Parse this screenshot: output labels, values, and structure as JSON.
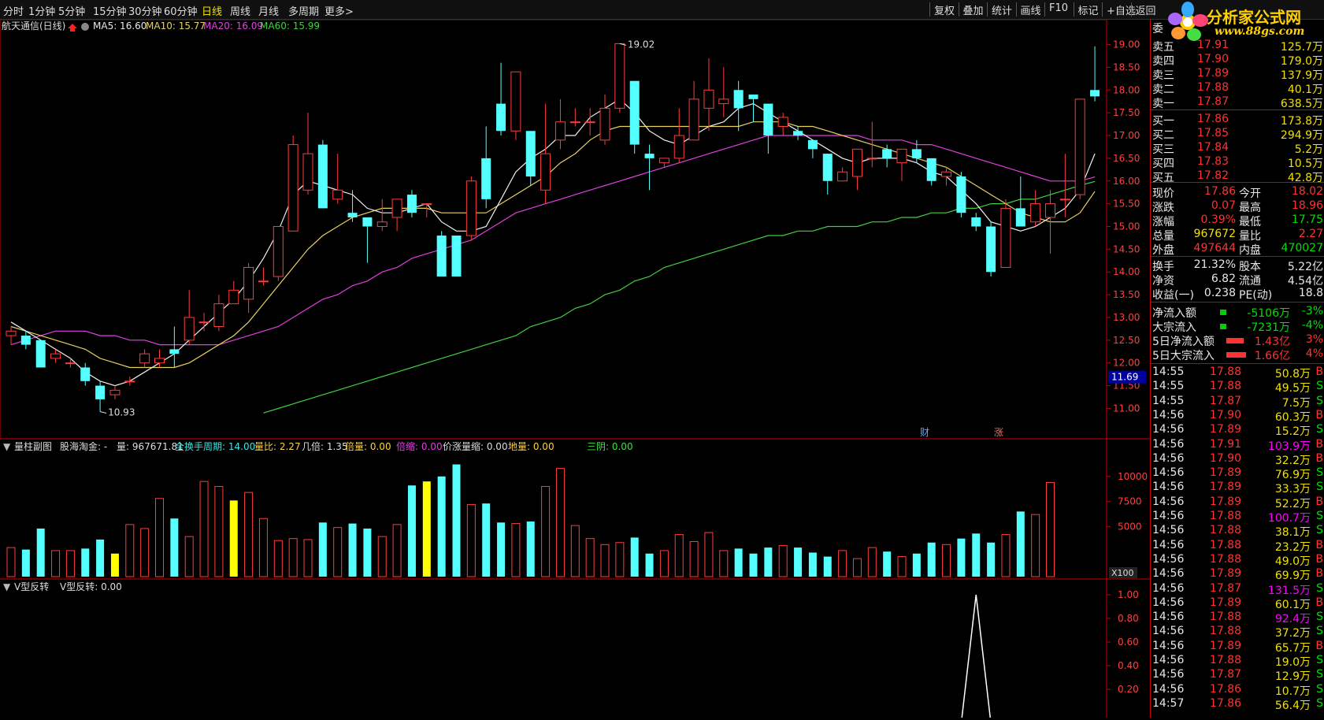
{
  "toolbar": {
    "periods": [
      "分时",
      "1分钟",
      "5分钟",
      "15分钟",
      "30分钟",
      "60分钟",
      "日线",
      "周线",
      "月线",
      "多周期",
      "更多>"
    ],
    "active_period": "日线",
    "tools": [
      "复权",
      "叠加",
      "统计",
      "画线",
      "F10",
      "标记",
      "+自选",
      "返回"
    ]
  },
  "logo": {
    "title": "分析家公式网",
    "url": "www.88gs.com"
  },
  "main_panel": {
    "stock_label": "航天通信(日线)",
    "ma5": "MA5: 16.60",
    "ma10": "MA10: 15.77",
    "ma20": "MA20: 16.09",
    "ma60": "MA60: 15.99",
    "high_mark": "19.02",
    "low_mark": "10.93",
    "current_price_tag": "11.69",
    "marker_cai": "财",
    "marker_zhang": "涨",
    "price_axis": [
      "19.00",
      "18.50",
      "18.00",
      "17.50",
      "17.00",
      "16.50",
      "16.00",
      "15.50",
      "15.00",
      "14.50",
      "14.00",
      "13.50",
      "13.00",
      "12.50",
      "12.00",
      "11.50",
      "11.00"
    ]
  },
  "volume_panel": {
    "title": "量柱副图",
    "label_gu": "股海淘金: -",
    "label_vol": "量: 967671.81",
    "label_period": "全换手周期: 14.00",
    "label_lb": "量比: 2.27",
    "label_jb": "几倍: 1.35",
    "label_bl": "倍量: 0.00",
    "label_bs": "倍缩: 0.00",
    "label_jz": "价涨量缩: 0.00",
    "label_dl": "地量: 0.00",
    "label_sy": "三阴: 0.00",
    "axis": [
      "10000",
      "7500",
      "5000"
    ],
    "unit": "X100"
  },
  "v_panel": {
    "title": "V型反转",
    "value_label": "V型反转: 0.00",
    "axis": [
      "1.00",
      "0.80",
      "0.60",
      "0.40",
      "0.20"
    ]
  },
  "quote": {
    "header": "委",
    "asks": [
      {
        "label": "卖五",
        "price": "17.91",
        "vol": "125.7万"
      },
      {
        "label": "卖四",
        "price": "17.90",
        "vol": "179.0万"
      },
      {
        "label": "卖三",
        "price": "17.89",
        "vol": "137.9万"
      },
      {
        "label": "卖二",
        "price": "17.88",
        "vol": "40.1万"
      },
      {
        "label": "卖一",
        "price": "17.87",
        "vol": "638.5万"
      }
    ],
    "bids": [
      {
        "label": "买一",
        "price": "17.86",
        "vol": "173.8万"
      },
      {
        "label": "买二",
        "price": "17.85",
        "vol": "294.9万"
      },
      {
        "label": "买三",
        "price": "17.84",
        "vol": "5.2万"
      },
      {
        "label": "买四",
        "price": "17.83",
        "vol": "10.5万"
      },
      {
        "label": "买五",
        "price": "17.82",
        "vol": "42.8万"
      }
    ],
    "stats": [
      {
        "l1": "现价",
        "v1": "17.86",
        "c1": "red",
        "l2": "今开",
        "v2": "18.02",
        "c2": "red"
      },
      {
        "l1": "涨跌",
        "v1": "0.07",
        "c1": "red",
        "l2": "最高",
        "v2": "18.96",
        "c2": "red"
      },
      {
        "l1": "涨幅",
        "v1": "0.39%",
        "c1": "red",
        "l2": "最低",
        "v2": "17.75",
        "c2": "green"
      },
      {
        "l1": "总量",
        "v1": "967672",
        "c1": "yellow",
        "l2": "量比",
        "v2": "2.27",
        "c2": "red"
      },
      {
        "l1": "外盘",
        "v1": "497644",
        "c1": "red",
        "l2": "内盘",
        "v2": "470027",
        "c2": "green"
      }
    ],
    "stats2": [
      {
        "l1": "换手",
        "v1": "21.32%",
        "c1": "white",
        "l2": "股本",
        "v2": "5.22亿",
        "c2": "white"
      },
      {
        "l1": "净资",
        "v1": "6.82",
        "c1": "white",
        "l2": "流通",
        "v2": "4.54亿",
        "c2": "white"
      },
      {
        "l1": "收益(一)",
        "v1": "0.238",
        "c1": "white",
        "l2": "PE(动)",
        "v2": "18.8",
        "c2": "white"
      }
    ],
    "flows": [
      {
        "label": "净流入额",
        "value": "-5106万",
        "pct": "-3%",
        "color": "green",
        "bar": 8
      },
      {
        "label": "大宗流入",
        "value": "-7231万",
        "pct": "-4%",
        "color": "green",
        "bar": 8
      },
      {
        "label": "5日净流入额",
        "value": "1.43亿",
        "pct": "3%",
        "color": "red",
        "bar": 22
      },
      {
        "label": "5日大宗流入",
        "value": "1.66亿",
        "pct": "4%",
        "color": "red",
        "bar": 25
      }
    ],
    "ticks": [
      {
        "t": "14:55",
        "p": "17.88",
        "v": "50.8万",
        "d": "B"
      },
      {
        "t": "14:55",
        "p": "17.88",
        "v": "49.5万",
        "d": "S"
      },
      {
        "t": "14:55",
        "p": "17.87",
        "v": "7.5万",
        "d": "S"
      },
      {
        "t": "14:56",
        "p": "17.90",
        "v": "60.3万",
        "d": "B"
      },
      {
        "t": "14:56",
        "p": "17.89",
        "v": "15.2万",
        "d": "S"
      },
      {
        "t": "14:56",
        "p": "17.91",
        "v": "103.9万",
        "d": "B"
      },
      {
        "t": "14:56",
        "p": "17.90",
        "v": "32.2万",
        "d": "B"
      },
      {
        "t": "14:56",
        "p": "17.89",
        "v": "76.9万",
        "d": "S"
      },
      {
        "t": "14:56",
        "p": "17.89",
        "v": "33.3万",
        "d": "S"
      },
      {
        "t": "14:56",
        "p": "17.89",
        "v": "52.2万",
        "d": "B"
      },
      {
        "t": "14:56",
        "p": "17.88",
        "v": "100.7万",
        "d": "S"
      },
      {
        "t": "14:56",
        "p": "17.88",
        "v": "38.1万",
        "d": "S"
      },
      {
        "t": "14:56",
        "p": "17.88",
        "v": "23.2万",
        "d": "B"
      },
      {
        "t": "14:56",
        "p": "17.88",
        "v": "49.0万",
        "d": "B"
      },
      {
        "t": "14:56",
        "p": "17.89",
        "v": "69.9万",
        "d": "B"
      },
      {
        "t": "14:56",
        "p": "17.87",
        "v": "131.5万",
        "d": "S"
      },
      {
        "t": "14:56",
        "p": "17.89",
        "v": "60.1万",
        "d": "B"
      },
      {
        "t": "14:56",
        "p": "17.88",
        "v": "92.4万",
        "d": "S"
      },
      {
        "t": "14:56",
        "p": "17.88",
        "v": "37.2万",
        "d": "S"
      },
      {
        "t": "14:56",
        "p": "17.89",
        "v": "65.7万",
        "d": "B"
      },
      {
        "t": "14:56",
        "p": "17.88",
        "v": "19.0万",
        "d": "S"
      },
      {
        "t": "14:56",
        "p": "17.87",
        "v": "12.9万",
        "d": "S"
      },
      {
        "t": "14:56",
        "p": "17.86",
        "v": "10.7万",
        "d": "S"
      },
      {
        "t": "14:57",
        "p": "17.86",
        "v": "56.4万",
        "d": "S"
      }
    ]
  },
  "chart_data": {
    "type": "candlestick",
    "ylim": [
      10.8,
      19.2
    ],
    "candles": [
      [
        12.6,
        12.7,
        12.4,
        12.8
      ],
      [
        12.6,
        12.4,
        12.3,
        12.7
      ],
      [
        12.5,
        11.9,
        11.9,
        12.5
      ],
      [
        12.1,
        12.2,
        12.0,
        12.3
      ],
      [
        12.0,
        12.0,
        11.9,
        12.1
      ],
      [
        11.9,
        11.6,
        11.5,
        12.0
      ],
      [
        11.5,
        11.2,
        10.93,
        11.6
      ],
      [
        11.3,
        11.4,
        11.2,
        11.5
      ],
      [
        11.6,
        11.6,
        11.5,
        11.7
      ],
      [
        12.0,
        12.2,
        11.9,
        12.3
      ],
      [
        12.0,
        12.1,
        11.9,
        12.3
      ],
      [
        12.3,
        12.2,
        11.9,
        12.8
      ],
      [
        12.5,
        13.0,
        12.4,
        13.6
      ],
      [
        12.9,
        12.9,
        12.7,
        13.1
      ],
      [
        12.8,
        13.3,
        12.7,
        13.5
      ],
      [
        13.3,
        13.6,
        13.3,
        13.8
      ],
      [
        13.4,
        14.1,
        13.1,
        14.2
      ],
      [
        13.8,
        13.8,
        13.7,
        14.1
      ],
      [
        13.9,
        15.0,
        13.8,
        15.0
      ],
      [
        14.9,
        16.8,
        14.9,
        17.0
      ],
      [
        15.8,
        16.6,
        15.7,
        17.5
      ],
      [
        16.8,
        15.4,
        15.4,
        16.9
      ],
      [
        15.6,
        15.8,
        15.5,
        16.6
      ],
      [
        15.3,
        15.2,
        15.1,
        15.8
      ],
      [
        15.2,
        15.0,
        14.2,
        15.2
      ],
      [
        15.0,
        15.1,
        14.9,
        15.6
      ],
      [
        15.2,
        15.6,
        14.9,
        15.6
      ],
      [
        15.7,
        15.3,
        15.2,
        15.8
      ],
      [
        15.5,
        15.5,
        15.2,
        15.5
      ],
      [
        14.8,
        13.9,
        13.9,
        14.9
      ],
      [
        14.8,
        13.9,
        13.9,
        14.8
      ],
      [
        14.8,
        16.0,
        14.7,
        16.1
      ],
      [
        16.5,
        15.6,
        15.4,
        17.2
      ],
      [
        17.7,
        17.1,
        17.0,
        18.6
      ],
      [
        17.1,
        18.4,
        16.9,
        18.4
      ],
      [
        17.1,
        16.1,
        15.9,
        16.2
      ],
      [
        15.8,
        16.6,
        15.5,
        17.7
      ],
      [
        16.9,
        17.3,
        16.7,
        17.8
      ],
      [
        17.3,
        17.3,
        17.2,
        17.6
      ],
      [
        17.3,
        17.3,
        17.0,
        17.6
      ],
      [
        16.9,
        17.6,
        16.8,
        17.9
      ],
      [
        17.6,
        19.02,
        17.5,
        19.02
      ],
      [
        18.2,
        16.8,
        16.6,
        18.2
      ],
      [
        16.6,
        16.5,
        15.8,
        16.8
      ],
      [
        16.4,
        16.5,
        16.3,
        16.5
      ],
      [
        16.5,
        17.0,
        16.4,
        17.6
      ],
      [
        16.9,
        17.8,
        16.9,
        18.2
      ],
      [
        17.6,
        18.0,
        17.1,
        18.7
      ],
      [
        17.7,
        17.8,
        17.4,
        18.5
      ],
      [
        18.0,
        17.6,
        17.1,
        18.2
      ],
      [
        17.9,
        17.8,
        17.3,
        17.9
      ],
      [
        17.7,
        17.0,
        16.6,
        17.7
      ],
      [
        17.2,
        17.4,
        17.0,
        17.5
      ],
      [
        17.1,
        17.0,
        16.9,
        17.2
      ],
      [
        16.9,
        16.7,
        16.5,
        16.9
      ],
      [
        16.6,
        16.0,
        15.7,
        16.6
      ],
      [
        16.0,
        16.2,
        16.0,
        16.3
      ],
      [
        16.1,
        16.7,
        15.8,
        16.7
      ],
      [
        16.5,
        16.5,
        16.3,
        17.3
      ],
      [
        16.7,
        16.5,
        16.3,
        16.8
      ],
      [
        16.4,
        16.7,
        16.0,
        16.7
      ],
      [
        16.7,
        16.5,
        16.4,
        16.9
      ],
      [
        16.5,
        16.0,
        15.9,
        16.5
      ],
      [
        16.1,
        16.2,
        15.9,
        16.3
      ],
      [
        16.1,
        15.3,
        15.2,
        16.2
      ],
      [
        15.2,
        15.0,
        14.9,
        15.3
      ],
      [
        15.0,
        14.0,
        13.9,
        15.1
      ],
      [
        14.1,
        15.4,
        14.1,
        15.6
      ],
      [
        15.4,
        15.0,
        15.0,
        16.1
      ],
      [
        15.1,
        15.5,
        15.0,
        15.8
      ],
      [
        15.2,
        15.5,
        14.4,
        15.8
      ],
      [
        15.6,
        15.6,
        15.2,
        16.6
      ],
      [
        15.7,
        17.8,
        15.6,
        17.8
      ],
      [
        18.0,
        17.86,
        17.75,
        18.96
      ]
    ],
    "ma5": [
      12.9,
      12.7,
      12.5,
      12.3,
      12.1,
      11.8,
      11.6,
      11.5,
      11.6,
      11.8,
      12.0,
      12.2,
      12.5,
      12.8,
      13.1,
      13.4,
      13.8,
      14.3,
      14.9,
      15.7,
      16.0,
      15.9,
      15.8,
      15.7,
      15.4,
      15.3,
      15.3,
      15.4,
      15.5,
      15.1,
      14.9,
      14.9,
      15.0,
      15.6,
      16.2,
      16.5,
      16.7,
      17.0,
      17.0,
      17.4,
      17.6,
      17.8,
      17.5,
      17.1,
      16.9,
      16.8,
      17.0,
      17.2,
      17.3,
      17.6,
      17.7,
      17.5,
      17.3,
      17.1,
      16.9,
      16.7,
      16.5,
      16.4,
      16.5,
      16.5,
      16.5,
      16.4,
      16.2,
      16.1,
      15.8,
      15.5,
      15.1,
      15.0,
      14.9,
      15.0,
      15.2,
      15.4,
      15.8,
      16.6
    ],
    "ma10": [
      12.8,
      12.7,
      12.6,
      12.5,
      12.4,
      12.3,
      12.1,
      12.0,
      11.9,
      11.9,
      11.9,
      11.9,
      12.0,
      12.2,
      12.4,
      12.6,
      12.9,
      13.3,
      13.7,
      14.1,
      14.5,
      14.8,
      15.0,
      15.2,
      15.3,
      15.4,
      15.4,
      15.4,
      15.4,
      15.3,
      15.3,
      15.3,
      15.3,
      15.5,
      15.7,
      15.9,
      16.1,
      16.4,
      16.6,
      16.9,
      17.1,
      17.2,
      17.2,
      17.2,
      17.2,
      17.2,
      17.2,
      17.2,
      17.2,
      17.2,
      17.3,
      17.3,
      17.3,
      17.2,
      17.2,
      17.1,
      17.0,
      16.9,
      16.8,
      16.7,
      16.6,
      16.5,
      16.4,
      16.3,
      16.1,
      15.9,
      15.7,
      15.5,
      15.3,
      15.2,
      15.1,
      15.1,
      15.3,
      15.77
    ],
    "ma20": [
      12.4,
      12.5,
      12.6,
      12.7,
      12.7,
      12.7,
      12.6,
      12.6,
      12.5,
      12.5,
      12.4,
      12.4,
      12.4,
      12.4,
      12.4,
      12.5,
      12.6,
      12.7,
      12.8,
      13.0,
      13.2,
      13.4,
      13.5,
      13.7,
      13.8,
      14.0,
      14.1,
      14.3,
      14.4,
      14.5,
      14.6,
      14.7,
      14.9,
      15.1,
      15.3,
      15.4,
      15.5,
      15.6,
      15.7,
      15.8,
      15.9,
      16.0,
      16.1,
      16.2,
      16.3,
      16.4,
      16.5,
      16.6,
      16.7,
      16.8,
      16.9,
      17.0,
      17.0,
      17.0,
      17.0,
      17.0,
      17.0,
      17.0,
      16.9,
      16.9,
      16.9,
      16.8,
      16.8,
      16.7,
      16.6,
      16.5,
      16.4,
      16.3,
      16.2,
      16.1,
      16.0,
      16.0,
      16.0,
      16.09
    ],
    "ma60_start": 10.9,
    "ma60": [
      10.9,
      11.0,
      11.1,
      11.2,
      11.3,
      11.4,
      11.5,
      11.6,
      11.7,
      11.8,
      11.9,
      12.0,
      12.1,
      12.2,
      12.3,
      12.4,
      12.5,
      12.6,
      12.8,
      12.9,
      13.0,
      13.2,
      13.3,
      13.5,
      13.6,
      13.8,
      13.9,
      14.1,
      14.2,
      14.3,
      14.4,
      14.5,
      14.6,
      14.7,
      14.8,
      14.8,
      14.9,
      14.9,
      15.0,
      15.0,
      15.0,
      15.1,
      15.1,
      15.2,
      15.2,
      15.3,
      15.3,
      15.4,
      15.4,
      15.5,
      15.5,
      15.6,
      15.6,
      15.7,
      15.8,
      15.9,
      15.99
    ],
    "volume": [
      2900,
      2700,
      4800,
      2600,
      2600,
      2800,
      3700,
      2300,
      5200,
      4800,
      7800,
      5800,
      4000,
      9500,
      9000,
      7600,
      8400,
      5800,
      3600,
      3800,
      3700,
      5400,
      4900,
      5300,
      4800,
      4000,
      5200,
      9100,
      9500,
      10000,
      11200,
      7200,
      7300,
      5400,
      5300,
      5500,
      9000,
      10800,
      5100,
      3800,
      3200,
      3400,
      3900,
      2300,
      2600,
      4200,
      3500,
      4400,
      2600,
      2800,
      2300,
      2900,
      3100,
      2900,
      2400,
      2000,
      2600,
      1800,
      2900,
      2500,
      2000,
      2300,
      3400,
      3200,
      3800,
      4300,
      3400,
      4200,
      6500,
      6200,
      9400
    ],
    "v_reversal": {
      "peak_index": 65,
      "peak_value": 1.0
    }
  }
}
